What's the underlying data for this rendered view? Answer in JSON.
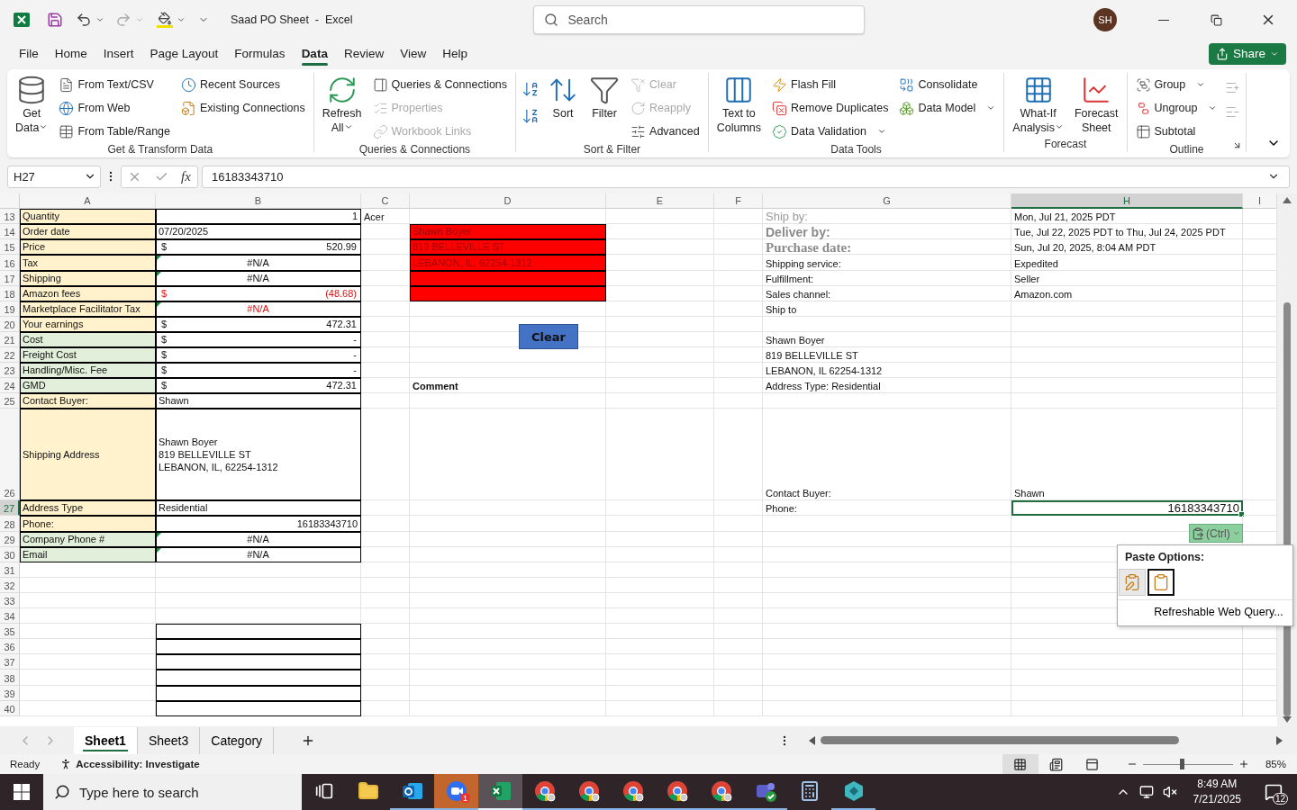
{
  "title_bar": {
    "title": "Saad PO Sheet  -  Excel",
    "search": {
      "placeholder": "Search"
    },
    "avatar": "SH"
  },
  "menu_tabs": [
    {
      "label": "File",
      "selected": false
    },
    {
      "label": "Home",
      "selected": false
    },
    {
      "label": "Insert",
      "selected": false
    },
    {
      "label": "Page Layout",
      "selected": false
    },
    {
      "label": "Formulas",
      "selected": false
    },
    {
      "label": "Data",
      "selected": true
    },
    {
      "label": "Review",
      "selected": false
    },
    {
      "label": "View",
      "selected": false
    },
    {
      "label": "Help",
      "selected": false
    }
  ],
  "share_button": "Share",
  "ribbon": {
    "groups": [
      {
        "label": "Get & Transform Data",
        "controls": [
          {
            "kind": "large",
            "label": "Get\nData",
            "caret": true
          },
          {
            "kind": "stack",
            "items": [
              {
                "label": "From Text/CSV",
                "disabled": false
              },
              {
                "label": "From Web",
                "disabled": false
              },
              {
                "label": "From Table/Range",
                "disabled": false
              }
            ]
          },
          {
            "kind": "stack",
            "items": [
              {
                "label": "Recent Sources",
                "disabled": false
              },
              {
                "label": "Existing Connections",
                "disabled": false
              }
            ]
          }
        ]
      },
      {
        "label": "Queries & Connections",
        "controls": [
          {
            "kind": "large",
            "label": "Refresh\nAll",
            "caret": true
          },
          {
            "kind": "stack",
            "items": [
              {
                "label": "Queries & Connections",
                "disabled": false
              },
              {
                "label": "Properties",
                "disabled": true
              },
              {
                "label": "Workbook Links",
                "disabled": true
              }
            ]
          }
        ]
      },
      {
        "label": "Sort & Filter",
        "controls": [
          {
            "kind": "sort-arrows"
          },
          {
            "kind": "large",
            "label": "Sort"
          },
          {
            "kind": "large",
            "label": "Filter"
          },
          {
            "kind": "stack",
            "items": [
              {
                "label": "Clear",
                "disabled": true
              },
              {
                "label": "Reapply",
                "disabled": true
              },
              {
                "label": "Advanced",
                "disabled": false
              }
            ]
          }
        ]
      },
      {
        "label": "Data Tools",
        "controls": [
          {
            "kind": "large",
            "label": "Text to\nColumns"
          },
          {
            "kind": "stack",
            "items": [
              {
                "label": "Flash Fill",
                "disabled": false
              },
              {
                "label": "Remove Duplicates",
                "disabled": false
              },
              {
                "label": "Data Validation",
                "disabled": false,
                "caret": true
              }
            ]
          },
          {
            "kind": "stack",
            "items": [
              {
                "label": "Consolidate",
                "disabled": false
              },
              {
                "label": "Data Model",
                "disabled": false,
                "caret": true
              }
            ]
          }
        ]
      },
      {
        "label": "Forecast",
        "controls": [
          {
            "kind": "large",
            "label": "What-If\nAnalysis",
            "caret": true
          },
          {
            "kind": "large",
            "label": "Forecast\nSheet"
          }
        ]
      },
      {
        "label": "Outline",
        "launcher": true,
        "controls": [
          {
            "kind": "stack",
            "items": [
              {
                "label": "Group",
                "disabled": false,
                "caret": true
              },
              {
                "label": "Ungroup",
                "disabled": false,
                "caret": true
              },
              {
                "label": "Subtotal",
                "disabled": false
              }
            ]
          },
          {
            "kind": "detail-arrows"
          }
        ]
      }
    ]
  },
  "formula_bar": {
    "name_box": "H27",
    "function_label": "fx",
    "value": "16183343710"
  },
  "columns": [
    {
      "letter": "A",
      "selected": false
    },
    {
      "letter": "B",
      "selected": false
    },
    {
      "letter": "C",
      "selected": false
    },
    {
      "letter": "D",
      "selected": false
    },
    {
      "letter": "E",
      "selected": false
    },
    {
      "letter": "F",
      "selected": false
    },
    {
      "letter": "G",
      "selected": false
    },
    {
      "letter": "H",
      "selected": true
    },
    {
      "letter": "I",
      "selected": false
    }
  ],
  "rows": [
    {
      "number": "13",
      "selected": false,
      "cells": [
        {
          "kind": "label",
          "color": "#fff2cc",
          "text": "Quantity"
        },
        {
          "kind": "number",
          "text": "1"
        },
        {
          "kind": "plain",
          "text": "Acer"
        },
        {
          "kind": "empty"
        },
        {
          "kind": "empty"
        },
        {
          "kind": "empty"
        },
        {
          "kind": "faded",
          "text": "Ship by:"
        },
        {
          "kind": "plain",
          "text": "Mon, Jul 21, 2025 PDT"
        }
      ]
    },
    {
      "number": "14",
      "selected": false,
      "cells": [
        {
          "kind": "label",
          "color": "#fff2cc",
          "text": "Order date"
        },
        {
          "kind": "value",
          "text": "07/20/2025"
        },
        {
          "kind": "empty"
        },
        {
          "kind": "fill",
          "color": "#ff0000",
          "text": "Shawn Boyer"
        },
        {
          "kind": "empty"
        },
        {
          "kind": "empty"
        },
        {
          "kind": "faded-bold",
          "text": "Deliver by:"
        },
        {
          "kind": "plain",
          "text": "Tue, Jul 22, 2025 PDT to Thu, Jul 24, 2025 PDT"
        }
      ]
    },
    {
      "number": "15",
      "selected": false,
      "cells": [
        {
          "kind": "label",
          "color": "#fff2cc",
          "text": "Price"
        },
        {
          "kind": "money",
          "currency": "$",
          "text": "520.99"
        },
        {
          "kind": "empty"
        },
        {
          "kind": "fill",
          "color": "#ff0000",
          "text": "819 BELLEVILLE ST"
        },
        {
          "kind": "empty"
        },
        {
          "kind": "empty"
        },
        {
          "kind": "faded-serif",
          "text": "Purchase date:"
        },
        {
          "kind": "plain",
          "text": "Sun, Jul 20, 2025, 8:04 AM PDT"
        }
      ]
    },
    {
      "number": "16",
      "selected": false,
      "cells": [
        {
          "kind": "label",
          "color": "#fff2cc",
          "text": "Tax"
        },
        {
          "kind": "error",
          "flag": true,
          "text": "#N/A"
        },
        {
          "kind": "empty"
        },
        {
          "kind": "fill",
          "color": "#ff0000",
          "text": "LEBANON, IL, 62254-1312"
        },
        {
          "kind": "empty"
        },
        {
          "kind": "empty"
        },
        {
          "kind": "plain",
          "text": "Shipping service:"
        },
        {
          "kind": "plain",
          "text": "Expedited"
        }
      ]
    },
    {
      "number": "17",
      "selected": false,
      "cells": [
        {
          "kind": "label",
          "color": "#fff2cc",
          "text": "Shipping"
        },
        {
          "kind": "error",
          "flag": true,
          "text": "#N/A"
        },
        {
          "kind": "empty"
        },
        {
          "kind": "fill",
          "color": "#ff0000"
        },
        {
          "kind": "empty"
        },
        {
          "kind": "empty"
        },
        {
          "kind": "plain",
          "text": "Fulfillment:"
        },
        {
          "kind": "plain",
          "text": "Seller"
        }
      ]
    },
    {
      "number": "18",
      "selected": false,
      "cells": [
        {
          "kind": "label",
          "color": "#fff2cc",
          "text": "Amazon fees"
        },
        {
          "kind": "money",
          "negative": true,
          "currency": "$",
          "text": "(48.68)"
        },
        {
          "kind": "empty"
        },
        {
          "kind": "fill",
          "color": "#ff0000"
        },
        {
          "kind": "empty"
        },
        {
          "kind": "empty"
        },
        {
          "kind": "plain",
          "text": "Sales channel:"
        },
        {
          "kind": "plain",
          "text": "Amazon.com"
        }
      ]
    },
    {
      "number": "19",
      "selected": false,
      "cells": [
        {
          "kind": "label",
          "color": "#fff2cc",
          "text": "Marketplace Facilitator Tax"
        },
        {
          "kind": "error",
          "flag": true,
          "negative": true,
          "text": "#N/A"
        },
        {
          "kind": "empty"
        },
        {
          "kind": "empty"
        },
        {
          "kind": "empty"
        },
        {
          "kind": "empty"
        },
        {
          "kind": "plain",
          "text": "Ship to"
        }
      ]
    },
    {
      "number": "20",
      "selected": false,
      "cells": [
        {
          "kind": "label",
          "color": "#fff2cc",
          "text": "Your earnings"
        },
        {
          "kind": "money",
          "currency": "$",
          "text": "472.31"
        }
      ]
    },
    {
      "number": "21",
      "selected": false,
      "cells": [
        {
          "kind": "label",
          "color": "#e2efda",
          "text": "Cost"
        },
        {
          "kind": "money",
          "currency": "$",
          "text": "-"
        },
        {
          "kind": "empty"
        },
        {
          "kind": "empty"
        },
        {
          "kind": "empty"
        },
        {
          "kind": "empty"
        },
        {
          "kind": "plain",
          "text": "Shawn Boyer"
        }
      ]
    },
    {
      "number": "22",
      "selected": false,
      "cells": [
        {
          "kind": "label",
          "color": "#e2efda",
          "text": "Freight Cost"
        },
        {
          "kind": "money",
          "currency": "$",
          "text": "-"
        },
        {
          "kind": "empty"
        },
        {
          "kind": "empty"
        },
        {
          "kind": "empty"
        },
        {
          "kind": "empty"
        },
        {
          "kind": "plain",
          "text": "819 BELLEVILLE ST"
        }
      ]
    },
    {
      "number": "23",
      "selected": false,
      "cells": [
        {
          "kind": "label",
          "color": "#e2efda",
          "text": "Handling/Misc. Fee"
        },
        {
          "kind": "money",
          "currency": "$",
          "text": "-"
        },
        {
          "kind": "empty"
        },
        {
          "kind": "empty"
        },
        {
          "kind": "empty"
        },
        {
          "kind": "empty"
        },
        {
          "kind": "plain",
          "text": "LEBANON, IL 62254-1312"
        }
      ]
    },
    {
      "number": "24",
      "selected": false,
      "cells": [
        {
          "kind": "label",
          "color": "#e2efda",
          "text": "GMD"
        },
        {
          "kind": "money",
          "currency": "$",
          "text": "472.31"
        },
        {
          "kind": "empty"
        },
        {
          "kind": "bold",
          "text": "Comment"
        },
        {
          "kind": "empty"
        },
        {
          "kind": "empty"
        },
        {
          "kind": "plain",
          "text": "Address Type:  Residential"
        }
      ]
    },
    {
      "number": "25",
      "selected": false,
      "cells": [
        {
          "kind": "label",
          "color": "#fff2cc",
          "text": "Contact Buyer:"
        },
        {
          "kind": "value",
          "text": "Shawn"
        }
      ]
    },
    {
      "number": "26",
      "selected": false,
      "tall": true,
      "cells": [
        {
          "kind": "label",
          "color": "#fff2cc",
          "text": "Shipping Address"
        },
        {
          "kind": "value",
          "text": "Shawn Boyer\n819 BELLEVILLE ST\nLEBANON, IL, 62254-1312"
        },
        {
          "kind": "empty"
        },
        {
          "kind": "empty"
        },
        {
          "kind": "empty"
        },
        {
          "kind": "empty"
        },
        {
          "kind": "plain",
          "text": "Contact Buyer:"
        },
        {
          "kind": "plain",
          "text": "Shawn"
        }
      ]
    },
    {
      "number": "27",
      "selected": true,
      "cells": [
        {
          "kind": "label",
          "color": "#fff2cc",
          "text": "Address Type"
        },
        {
          "kind": "value",
          "text": "Residential"
        },
        {
          "kind": "empty"
        },
        {
          "kind": "empty"
        },
        {
          "kind": "empty"
        },
        {
          "kind": "empty"
        },
        {
          "kind": "plain",
          "text": "Phone:"
        },
        {
          "kind": "plain-number",
          "text": "16183343710"
        }
      ]
    },
    {
      "number": "28",
      "selected": false,
      "cells": [
        {
          "kind": "label",
          "color": "#fff2cc",
          "text": "Phone:"
        },
        {
          "kind": "number",
          "text": "16183343710"
        }
      ]
    },
    {
      "number": "29",
      "selected": false,
      "cells": [
        {
          "kind": "label",
          "color": "#e2efda",
          "text": "Company Phone #"
        },
        {
          "kind": "error",
          "flag": true,
          "text": "#N/A"
        }
      ]
    },
    {
      "number": "30",
      "selected": false,
      "cells": [
        {
          "kind": "label",
          "color": "#e2efda",
          "text": "Email"
        },
        {
          "kind": "error",
          "flag": true,
          "text": "#N/A"
        }
      ]
    },
    {
      "number": "31",
      "selected": false,
      "cells": []
    },
    {
      "number": "32",
      "selected": false,
      "cells": []
    },
    {
      "number": "33",
      "selected": false,
      "cells": []
    },
    {
      "number": "34",
      "selected": false,
      "cells": []
    },
    {
      "number": "35",
      "selected": false,
      "cells": [
        {
          "kind": "empty"
        },
        {
          "kind": "box"
        }
      ]
    },
    {
      "number": "36",
      "selected": false,
      "cells": [
        {
          "kind": "empty"
        },
        {
          "kind": "box"
        }
      ]
    },
    {
      "number": "37",
      "selected": false,
      "cells": [
        {
          "kind": "empty"
        },
        {
          "kind": "box"
        }
      ]
    },
    {
      "number": "38",
      "selected": false,
      "cells": [
        {
          "kind": "empty"
        },
        {
          "kind": "box"
        }
      ]
    },
    {
      "number": "39",
      "selected": false,
      "cells": [
        {
          "kind": "empty"
        },
        {
          "kind": "box"
        }
      ]
    },
    {
      "number": "40",
      "selected": false,
      "cells": [
        {
          "kind": "empty"
        },
        {
          "kind": "box"
        }
      ]
    }
  ],
  "clear_button": "Clear",
  "paste_button": "(Ctrl)",
  "paste_menu": {
    "title": "Paste Options:",
    "options": [
      {
        "selected": false
      },
      {
        "selected": true
      }
    ],
    "item": "Refreshable Web Query..."
  },
  "sheet_tabs": [
    {
      "label": "Sheet1",
      "selected": true
    },
    {
      "label": "Sheet3",
      "selected": false
    },
    {
      "label": "Category",
      "selected": false
    }
  ],
  "status_bar": {
    "state": "Ready",
    "accessibility": "Accessibility: Investigate",
    "views": [
      {
        "selected": true
      },
      {
        "selected": false
      },
      {
        "selected": false
      }
    ],
    "zoom": {
      "level": 0.43,
      "reading": "85%"
    }
  },
  "taskbar": {
    "search_placeholder": "Type here to search",
    "apps": [
      {
        "running": false,
        "selected": false,
        "flashing": false
      },
      {
        "running": false,
        "selected": false,
        "flashing": false
      },
      {
        "running": true,
        "selected": false,
        "flashing": false
      },
      {
        "running": true,
        "selected": false,
        "flashing": true,
        "badge": "1"
      },
      {
        "running": true,
        "selected": true,
        "flashing": false
      },
      {
        "running": true,
        "selected": false,
        "flashing": false
      },
      {
        "running": true,
        "selected": false,
        "flashing": false
      },
      {
        "running": true,
        "selected": false,
        "flashing": false
      },
      {
        "running": true,
        "selected": false,
        "flashing": false
      },
      {
        "running": true,
        "selected": false,
        "flashing": false
      },
      {
        "running": true,
        "selected": false,
        "flashing": false
      },
      {
        "running": false,
        "selected": false,
        "flashing": false
      },
      {
        "running": true,
        "selected": false,
        "flashing": false
      }
    ],
    "time": "8:49 AM",
    "date": "7/21/2025",
    "notifications": "12"
  }
}
